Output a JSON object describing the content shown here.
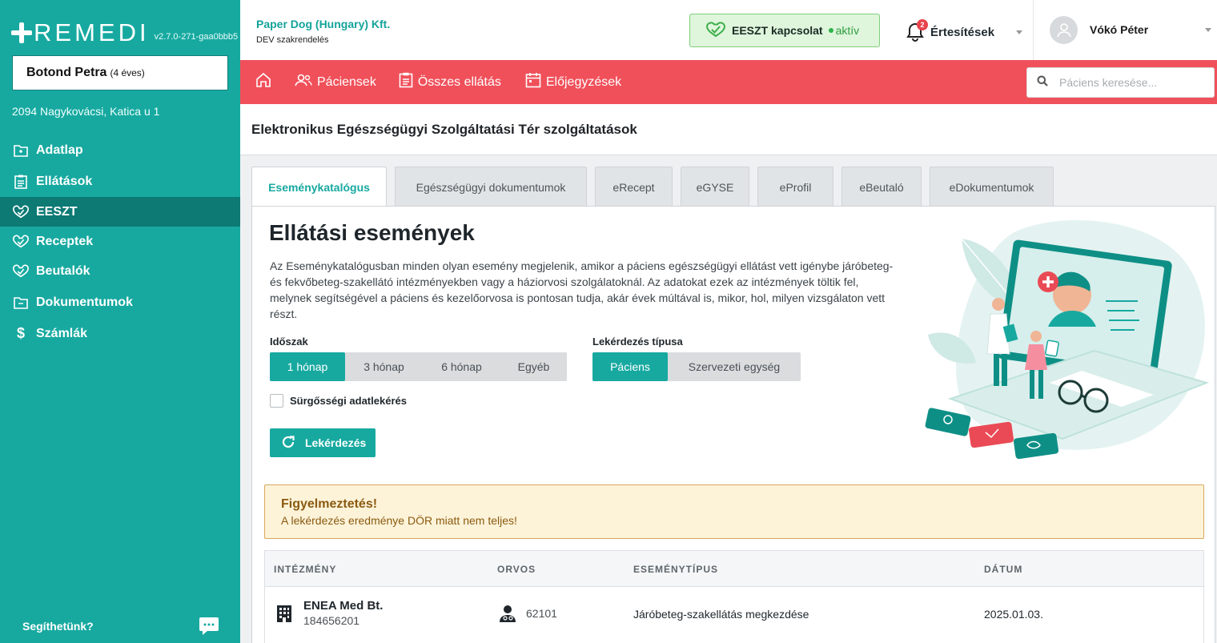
{
  "app": {
    "logo": "REMEDI",
    "version": "v2.7.0-271-gaa0bbb5"
  },
  "patient": {
    "name": "Botond Petra",
    "age": "(4 éves)",
    "address": "2094 Nagykovácsi, Katica u 1"
  },
  "sidebar": {
    "items": [
      {
        "label": "Adatlap",
        "icon": "folder-user-icon"
      },
      {
        "label": "Ellátások",
        "icon": "clipboard-icon"
      },
      {
        "label": "EESZT",
        "icon": "eeszt-icon",
        "active": true
      },
      {
        "label": "Receptek",
        "icon": "eeszt-icon"
      },
      {
        "label": "Beutalók",
        "icon": "eeszt-icon"
      },
      {
        "label": "Dokumentumok",
        "icon": "folder-icon"
      },
      {
        "label": "Számlák",
        "icon": "dollar-icon"
      }
    ],
    "help_label": "Segíthetünk?"
  },
  "topbar": {
    "org_name": "Paper Dog (Hungary) Kft.",
    "org_unit": "DEV szakrendelés",
    "eeszt_label": "EESZT kapcsolat",
    "eeszt_status": "aktív",
    "notifications_label": "Értesítések",
    "notifications_count": "2",
    "user_name": "Vókó Péter"
  },
  "nav": {
    "items": [
      {
        "label": "Páciensek",
        "icon": "users-icon"
      },
      {
        "label": "Összes ellátás",
        "icon": "clipboard-icon"
      },
      {
        "label": "Előjegyzések",
        "icon": "calendar-icon"
      }
    ],
    "search_placeholder": "Páciens keresése..."
  },
  "page": {
    "title": "Elektronikus Egészségügyi Szolgáltatási Tér szolgáltatások"
  },
  "tabs": [
    {
      "label": "Eseménykatalógus",
      "active": true
    },
    {
      "label": "Egészségügyi dokumentumok"
    },
    {
      "label": "eRecept"
    },
    {
      "label": "eGYSE"
    },
    {
      "label": "eProfil"
    },
    {
      "label": "eBeutaló"
    },
    {
      "label": "eDokumentumok"
    }
  ],
  "section": {
    "title": "Ellátási események",
    "description": "Az Eseménykatalógusban minden olyan esemény megjelenik, amikor a páciens egészségügyi ellátást vett igénybe járóbeteg- és fekvőbeteg-szakellátó intézményekben vagy a háziorvosi szolgálatoknál. Az adatokat ezek az intézmények töltik fel, melynek segítségével a páciens és kezelőorvosa is pontosan tudja, akár évek múltával is, mikor, hol, milyen vizsgálaton vett részt.",
    "period_label": "Időszak",
    "period_options": [
      "1 hónap",
      "3 hónap",
      "6 hónap",
      "Egyéb"
    ],
    "period_selected": "1 hónap",
    "query_type_label": "Lekérdezés típusa",
    "query_type_options": [
      "Páciens",
      "Szervezeti egység"
    ],
    "query_type_selected": "Páciens",
    "urgent_label": "Sürgősségi adatlekérés",
    "urgent_checked": false,
    "query_button": "Lekérdezés"
  },
  "warning": {
    "title": "Figyelmeztetés!",
    "text": "A lekérdezés eredménye DÖR miatt nem teljes!"
  },
  "table": {
    "headers": [
      "INTÉZMÉNY",
      "ORVOS",
      "ESEMÉNYTÍPUS",
      "DÁTUM"
    ],
    "rows": [
      {
        "institution": "ENEA Med Bt.",
        "institution_id": "184656201",
        "doctor": "62101",
        "event_type": "Járóbeteg-szakellátás megkezdése",
        "date": "2025.01.03."
      }
    ]
  },
  "colors": {
    "brand_teal": "#17a9a0",
    "sidebar_active": "#0d7a74",
    "nav_red": "#f0505a",
    "warning_bg": "#fdf3d9"
  }
}
